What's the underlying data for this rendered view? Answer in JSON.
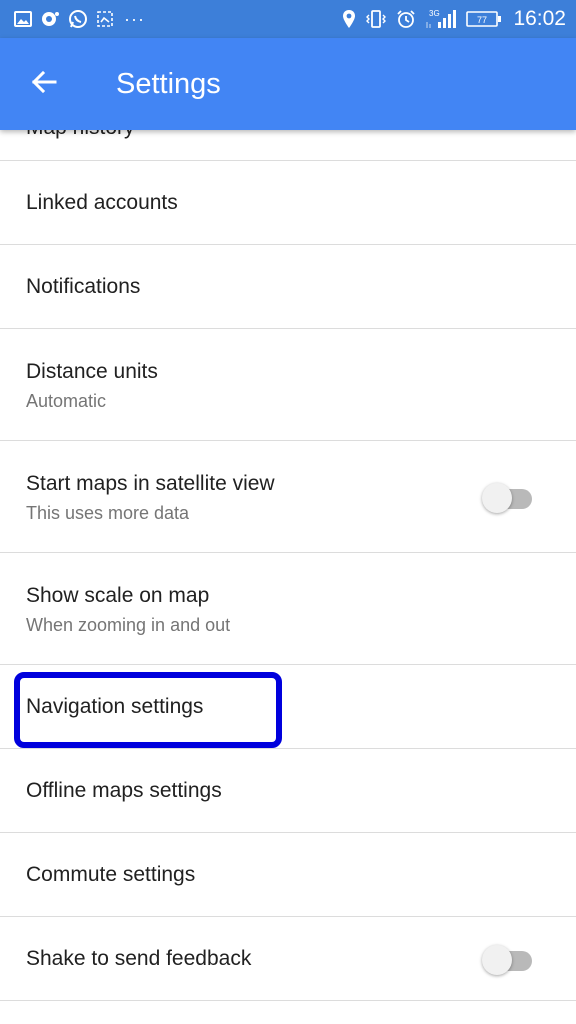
{
  "status_bar": {
    "time": "16:02",
    "network_label": "3G",
    "battery_level": "77",
    "left_icons": [
      "gallery-icon",
      "notification-app-icon",
      "whatsapp-icon",
      "screenshot-icon",
      "more-notifications-icon"
    ],
    "right_icons": [
      "location-icon",
      "vibrate-icon",
      "alarm-icon",
      "signal-icon",
      "battery-icon"
    ]
  },
  "app_bar": {
    "title": "Settings",
    "back_icon": "arrow-back-icon"
  },
  "settings": {
    "partial_item": "Map history",
    "items": [
      {
        "title": "Linked accounts"
      },
      {
        "title": "Notifications"
      },
      {
        "title": "Distance units",
        "subtitle": "Automatic"
      },
      {
        "title": "Start maps in satellite view",
        "subtitle": "This uses more data",
        "toggle": false
      },
      {
        "title": "Show scale on map",
        "subtitle": "When zooming in and out"
      },
      {
        "title": "Navigation settings",
        "highlighted": true
      },
      {
        "title": "Offline maps settings"
      },
      {
        "title": "Commute settings"
      },
      {
        "title": "Shake to send feedback",
        "toggle": false
      }
    ]
  },
  "colors": {
    "status_bar": "#3d7fd9",
    "app_bar": "#4285f4",
    "highlight": "#0000dd",
    "divider": "#dcdcdc",
    "text_primary": "#212121",
    "text_secondary": "#757575"
  }
}
